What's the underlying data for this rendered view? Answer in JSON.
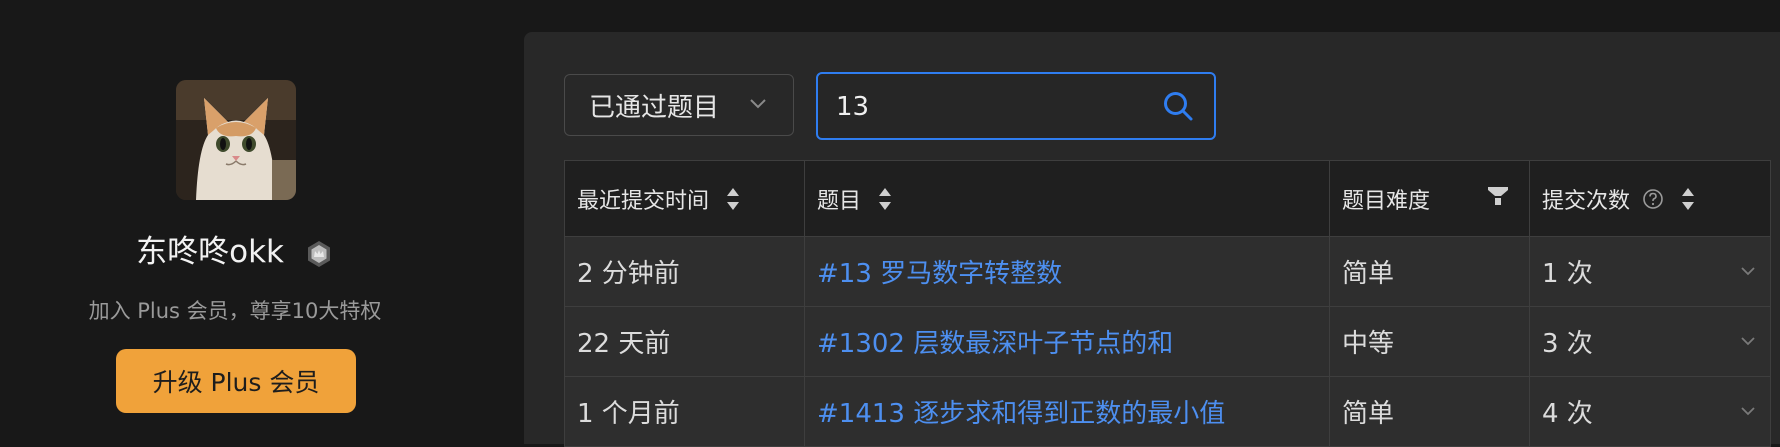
{
  "profile": {
    "username": "东咚咚okk",
    "plus_desc": "加入 Plus 会员，尊享10大特权",
    "upgrade_label": "升级 Plus 会员"
  },
  "filter": {
    "selected": "已通过题目"
  },
  "search": {
    "value": "13"
  },
  "table": {
    "headers": {
      "time": "最近提交时间",
      "problem": "题目",
      "difficulty": "题目难度",
      "submissions": "提交次数"
    },
    "rows": [
      {
        "time": "2 分钟前",
        "problem": "#13 罗马数字转整数",
        "difficulty": "简单",
        "submissions": "1 次"
      },
      {
        "time": "22 天前",
        "problem": "#1302 层数最深叶子节点的和",
        "difficulty": "中等",
        "submissions": "3 次"
      },
      {
        "time": "1 个月前",
        "problem": "#1413 逐步求和得到正数的最小值",
        "difficulty": "简单",
        "submissions": "4 次"
      }
    ]
  },
  "colors": {
    "accent": "#2f7df0",
    "plus": "#f0a23a",
    "easy": "#6cba3c",
    "medium": "#f0a23a",
    "link": "#4d8ff0"
  }
}
